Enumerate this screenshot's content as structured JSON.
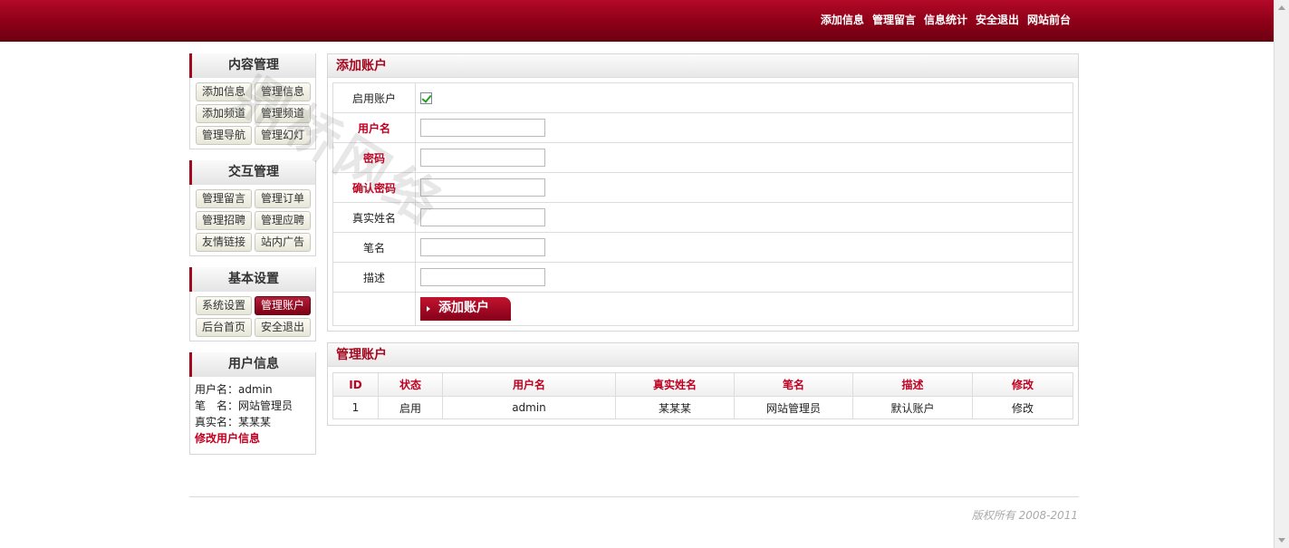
{
  "topnav": [
    "添加信息",
    "管理留言",
    "信息统计",
    "安全退出",
    "网站前台"
  ],
  "sidebar": {
    "content": {
      "title": "内容管理",
      "items": [
        "添加信息",
        "管理信息",
        "添加频道",
        "管理频道",
        "管理导航",
        "管理幻灯"
      ]
    },
    "interact": {
      "title": "交互管理",
      "items": [
        "管理留言",
        "管理订单",
        "管理招聘",
        "管理应聘",
        "友情链接",
        "站内广告"
      ]
    },
    "basic": {
      "title": "基本设置",
      "items": [
        "系统设置",
        "管理账户",
        "后台首页",
        "安全退出"
      ],
      "active": "管理账户"
    },
    "user": {
      "title": "用户信息",
      "username_label": "用户名：",
      "username": "admin",
      "pen_label": "笔　名：",
      "pen": "网站管理员",
      "realname_label": "真实名：",
      "realname": "某某某",
      "edit_link": "修改用户信息"
    }
  },
  "add_form": {
    "title": "添加账户",
    "enable_label": "启用账户",
    "enable_checked": true,
    "username_label": "用户名",
    "password_label": "密码",
    "confirm_label": "确认密码",
    "realname_label": "真实姓名",
    "pen_label": "笔名",
    "desc_label": "描述",
    "username_value": "",
    "password_value": "",
    "confirm_value": "",
    "realname_value": "",
    "pen_value": "",
    "desc_value": "",
    "submit_label": "添加账户"
  },
  "list": {
    "title": "管理账户",
    "columns": [
      "ID",
      "状态",
      "用户名",
      "真实姓名",
      "笔名",
      "描述",
      "修改"
    ],
    "rows": [
      [
        "1",
        "启用",
        "admin",
        "某某某",
        "网站管理员",
        "默认账户",
        "修改"
      ]
    ]
  },
  "footer": {
    "copyright": "版权所有 2008-2011"
  },
  "watermark": "鼎桥网络",
  "colors": {
    "brand": "#a3081f",
    "accent_text": "#c00020"
  }
}
